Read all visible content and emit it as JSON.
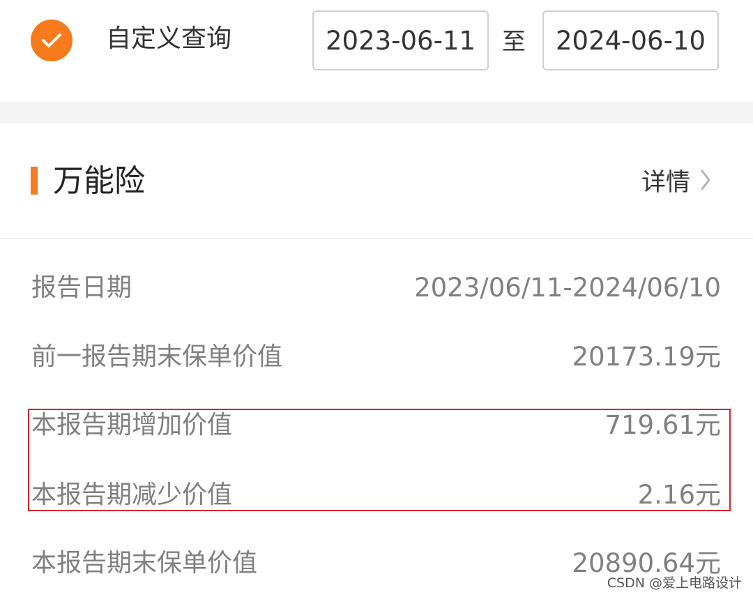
{
  "query": {
    "checked": true,
    "label": "自定义查询",
    "start_date": "2023-06-11",
    "to_label": "至",
    "end_date": "2024-06-10"
  },
  "section": {
    "title": "万能险",
    "details_label": "详情"
  },
  "rows": [
    {
      "label": "报告日期",
      "value": "2023/06/11-2024/06/10"
    },
    {
      "label": "前一报告期末保单价值",
      "value": "20173.19元"
    },
    {
      "label": "本报告期增加价值",
      "value": "719.61元"
    },
    {
      "label": "本报告期减少价值",
      "value": "2.16元"
    },
    {
      "label": "本报告期末保单价值",
      "value": "20890.64元"
    }
  ],
  "watermark": "CSDN @爱上电路设计",
  "colors": {
    "accent": "#f77a1c",
    "highlight": "#d9232e"
  },
  "icons": {
    "check": "check-icon",
    "chevron": "chevron-right-icon"
  }
}
